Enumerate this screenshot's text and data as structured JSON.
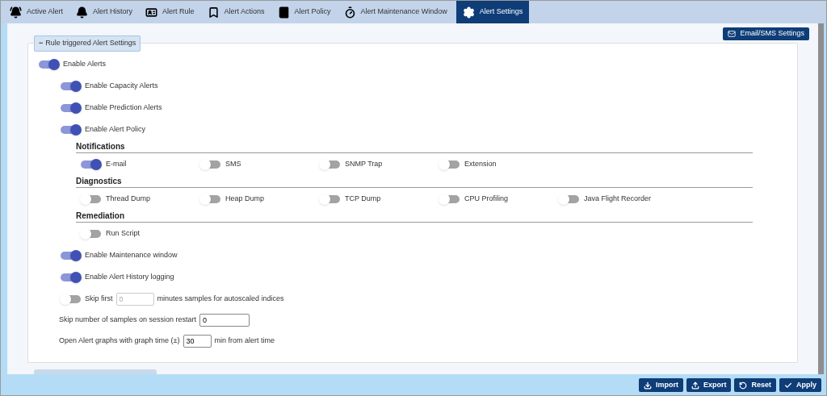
{
  "tabs": [
    {
      "label": "Active Alert",
      "selected": false
    },
    {
      "label": "Alert History",
      "selected": false
    },
    {
      "label": "Alert Rule",
      "selected": false
    },
    {
      "label": "Alert Actions",
      "selected": false
    },
    {
      "label": "Alert Policy",
      "selected": false
    },
    {
      "label": "Alert Maintenance Window",
      "selected": false
    },
    {
      "label": "Alert Settings",
      "selected": true
    }
  ],
  "email_sms_button": "Email/SMS Settings",
  "panel": {
    "legend_sign": "−",
    "legend": "Rule triggered Alert Settings"
  },
  "master_toggle": {
    "label": "Enable Alerts",
    "on": true,
    "children": [
      {
        "label": "Enable Capacity Alerts",
        "on": true
      },
      {
        "label": "Enable Prediction Alerts",
        "on": true
      },
      {
        "label": "Enable Alert Policy",
        "on": true
      }
    ]
  },
  "action_groups": [
    {
      "title": "Notifications",
      "options": [
        {
          "label": "E-mail",
          "on": true
        },
        {
          "label": "SMS",
          "on": false
        },
        {
          "label": "SNMP Trap",
          "on": false
        },
        {
          "label": "Extension",
          "on": false
        }
      ]
    },
    {
      "title": "Diagnostics",
      "options": [
        {
          "label": "Thread Dump",
          "on": false
        },
        {
          "label": "Heap Dump",
          "on": false
        },
        {
          "label": "TCP Dump",
          "on": false
        },
        {
          "label": "CPU Profiling",
          "on": false
        },
        {
          "label": "Java Flight Recorder",
          "on": false
        }
      ]
    },
    {
      "title": "Remediation",
      "options": [
        {
          "label": "Run Script",
          "on": false
        }
      ]
    }
  ],
  "more_toggles": [
    {
      "label": "Enable Maintenance window",
      "on": true
    },
    {
      "label": "Enable Alert History logging",
      "on": true
    }
  ],
  "skip_first": {
    "on": false,
    "prefix": "Skip first",
    "placeholder": "0",
    "suffix": "minutes samples for autoscaled indices"
  },
  "fields": [
    {
      "label": "Skip number of samples on session restart",
      "value": "0"
    },
    {
      "label": "Open Alert graphs with graph time (±)",
      "value": "30",
      "suffix": "min from alert time"
    }
  ],
  "footer_buttons": [
    {
      "label": "Import"
    },
    {
      "label": "Export"
    },
    {
      "label": "Reset"
    },
    {
      "label": "Apply"
    }
  ]
}
